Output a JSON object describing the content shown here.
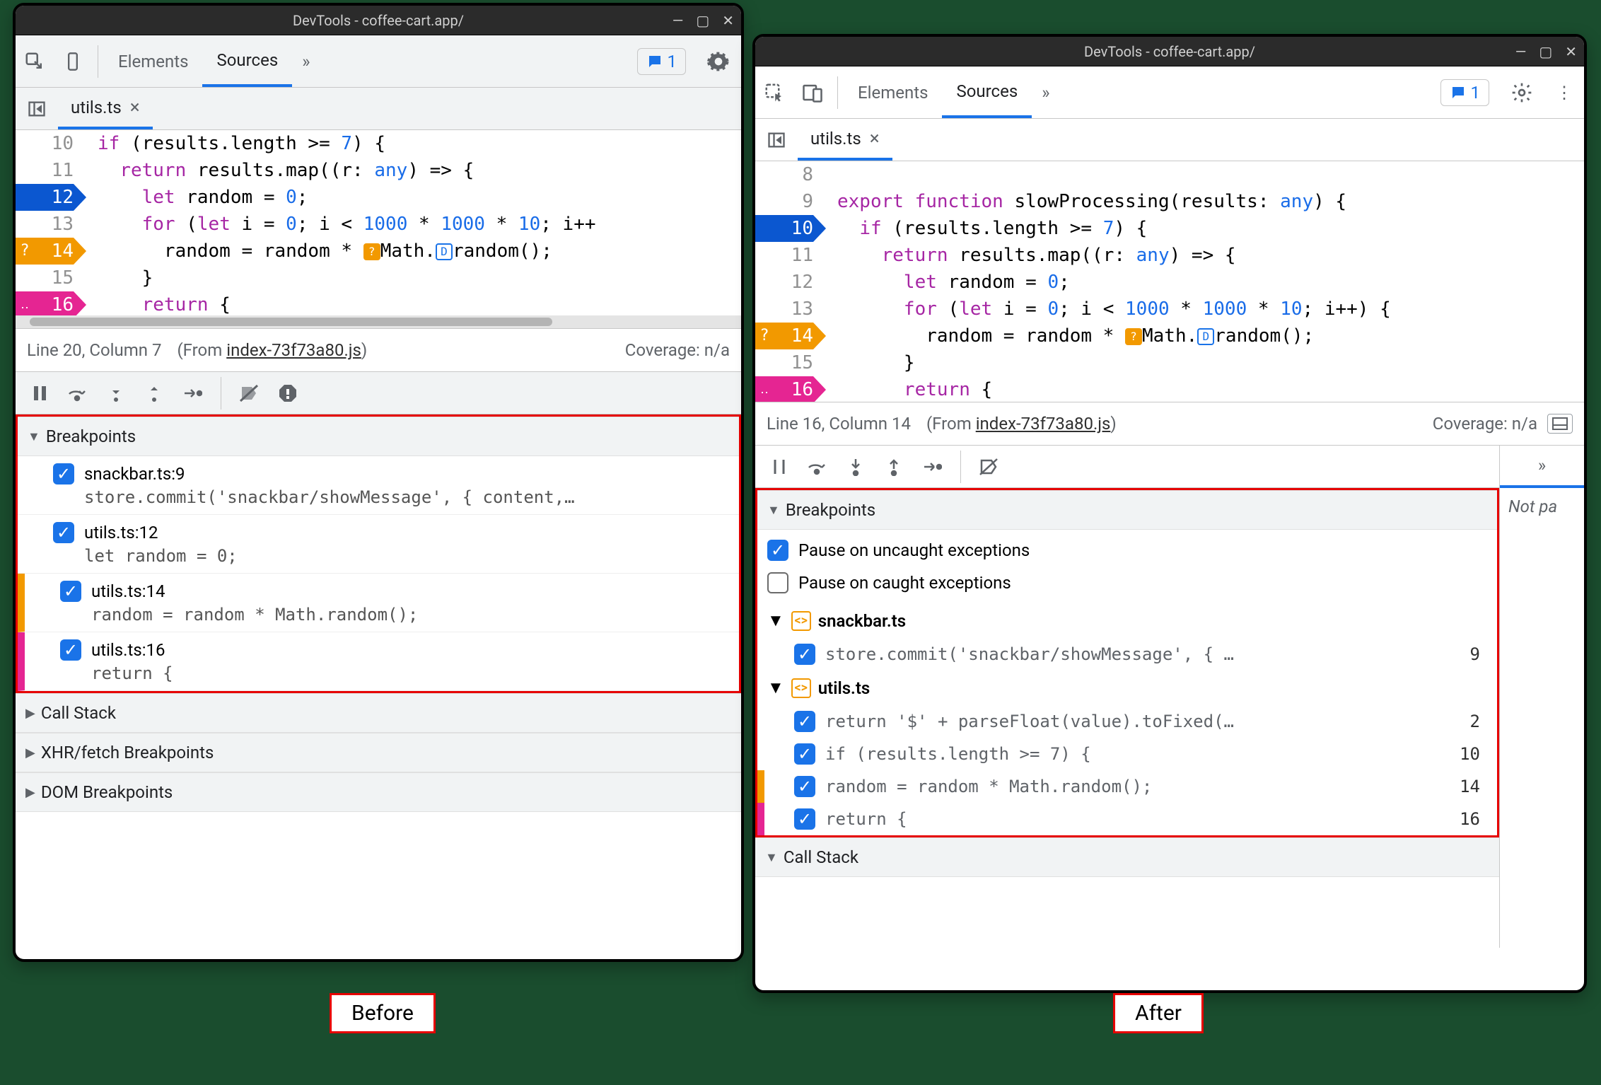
{
  "title": "DevTools - coffee-cart.app/",
  "tabs": {
    "elements": "Elements",
    "sources": "Sources"
  },
  "msg_count": "1",
  "file_tab": "utils.ts",
  "before": {
    "lines": [
      {
        "n": "10",
        "txt": "  if (results.length >= 7) {"
      },
      {
        "n": "11",
        "txt": "    return results.map((r: any) => {"
      },
      {
        "n": "12",
        "txt": "      let random = 0;",
        "bp": "blue"
      },
      {
        "n": "13",
        "txt": "      for (let i = 0; i < 1000 * 1000 * 10; i++"
      },
      {
        "n": "14",
        "txt": "        random = random * Math.random();",
        "bp": "cond",
        "flag": "?"
      },
      {
        "n": "15",
        "txt": "      }"
      },
      {
        "n": "16",
        "txt": "      return {",
        "bp": "log",
        "flag": ".."
      }
    ],
    "status_pos": "Line 20, Column 7",
    "status_from": "index-73f73a80.js",
    "status_cov": "Coverage: n/a",
    "bp_header": "Breakpoints",
    "bps": [
      {
        "file": "snackbar.ts:9",
        "code": "store.commit('snackbar/showMessage', { content,…"
      },
      {
        "file": "utils.ts:12",
        "code": "let random = 0;"
      },
      {
        "file": "utils.ts:14",
        "code": "random = random * Math.random();",
        "stripe": "orange"
      },
      {
        "file": "utils.ts:16",
        "code": "return {",
        "stripe": "pink"
      }
    ],
    "panes": [
      "Call Stack",
      "XHR/fetch Breakpoints",
      "DOM Breakpoints"
    ]
  },
  "after": {
    "lines": [
      {
        "n": "8",
        "txt": ""
      },
      {
        "n": "9",
        "txt": "export function slowProcessing(results: any) {"
      },
      {
        "n": "10",
        "txt": "  if (results.length >= 7) {",
        "bp": "blue"
      },
      {
        "n": "11",
        "txt": "    return results.map((r: any) => {"
      },
      {
        "n": "12",
        "txt": "      let random = 0;"
      },
      {
        "n": "13",
        "txt": "      for (let i = 0; i < 1000 * 1000 * 10; i++) {"
      },
      {
        "n": "14",
        "txt": "        random = random * Math.random();",
        "bp": "cond",
        "flag": "?"
      },
      {
        "n": "15",
        "txt": "      }"
      },
      {
        "n": "16",
        "txt": "      return {",
        "bp": "log",
        "flag": ".."
      }
    ],
    "status_pos": "Line 16, Column 14",
    "status_from": "index-73f73a80.js",
    "status_cov": "Coverage: n/a",
    "bp_header": "Breakpoints",
    "pause_uncaught": "Pause on uncaught exceptions",
    "pause_caught": "Pause on caught exceptions",
    "groups": [
      {
        "file": "snackbar.ts",
        "items": [
          {
            "code": "store.commit('snackbar/showMessage', { …",
            "ln": "9"
          }
        ]
      },
      {
        "file": "utils.ts",
        "items": [
          {
            "code": "return '$' + parseFloat(value).toFixed(…",
            "ln": "2"
          },
          {
            "code": "if (results.length >= 7) {",
            "ln": "10"
          },
          {
            "code": "random = random * Math.random();",
            "ln": "14",
            "stripe": "orange"
          },
          {
            "code": "return {",
            "ln": "16",
            "stripe": "pink"
          }
        ]
      }
    ],
    "callstack": "Call Stack",
    "notpa": "Not pa"
  },
  "labels": {
    "before": "Before",
    "after": "After",
    "from": "(From "
  }
}
